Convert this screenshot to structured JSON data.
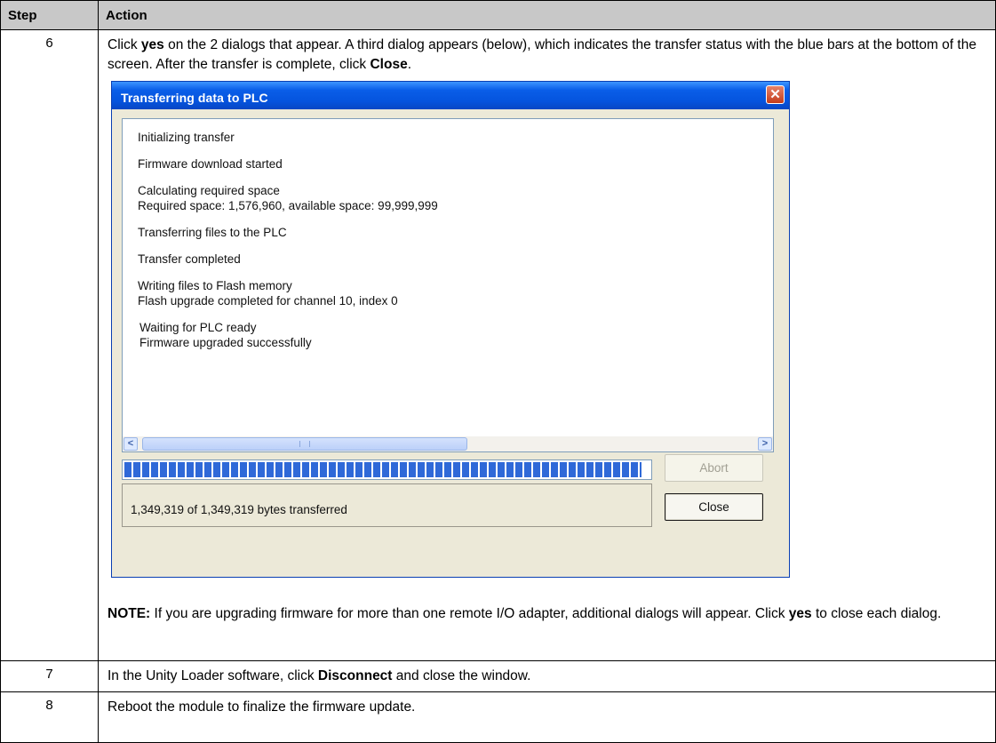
{
  "table": {
    "header_step": "Step",
    "header_action": "Action"
  },
  "rows": {
    "r6": {
      "step": "6",
      "p_a": "Click ",
      "p_b": "yes",
      "p_c": " on the 2 dialogs that appear. A third dialog appears (below), which indicates the transfer status with the blue bars at the bottom of the screen. After the transfer is complete, click ",
      "p_d": "Close",
      "p_e": ".",
      "note_label": "NOTE:",
      "note_a": " If you are upgrading firmware for more than one remote I/O adapter, additional dialogs will appear. Click ",
      "note_b": "yes",
      "note_c": " to close each dialog."
    },
    "r7": {
      "step": "7",
      "a": "In the Unity Loader software, click ",
      "b": "Disconnect",
      "c": " and close the window."
    },
    "r8": {
      "step": "8",
      "text": "Reboot the module to finalize the firmware update."
    }
  },
  "dialog": {
    "title": "Transferring data to PLC",
    "close_glyph": "✕",
    "log": [
      [
        "Initializing transfer"
      ],
      [
        "Firmware download started"
      ],
      [
        "Calculating required space",
        "Required space: 1,576,960, available space: 99,999,999"
      ],
      [
        "Transferring files to the PLC"
      ],
      [
        "Transfer completed"
      ],
      [
        "Writing files to Flash memory",
        "Flash upgrade completed for channel 10, index 0"
      ],
      [
        "Waiting for PLC ready",
        "Firmware upgraded successfully"
      ]
    ],
    "scroll_left": "<",
    "scroll_right": ">",
    "progress_fraction": 0.985,
    "progress_color": "#2f69d8",
    "status_text": "1,349,319 of 1,349,319 bytes transferred",
    "abort_label": "Abort",
    "close_label": "Close"
  }
}
